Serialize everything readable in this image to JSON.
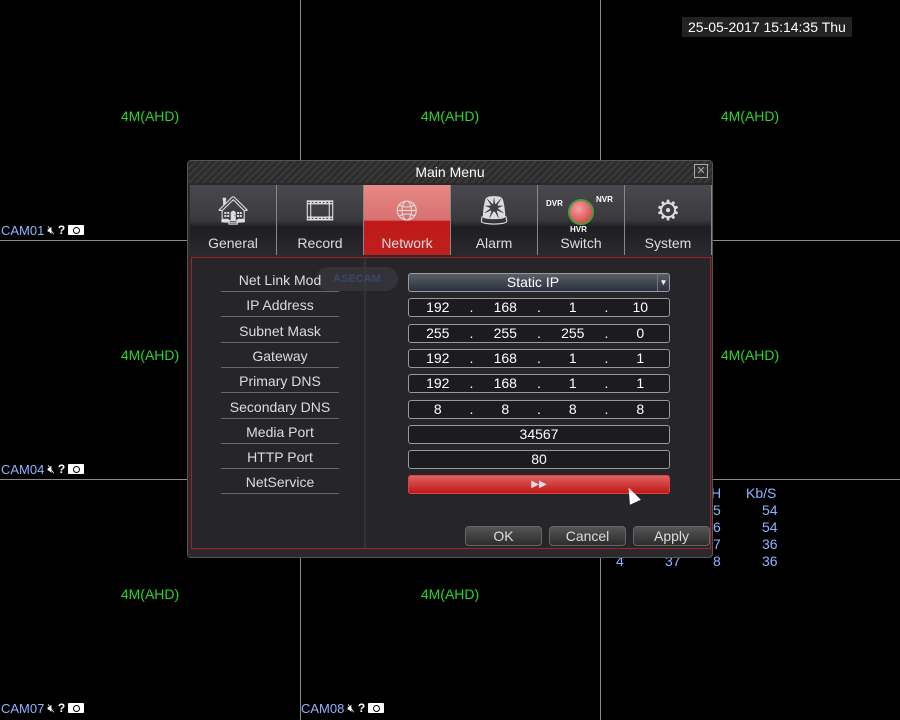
{
  "clock": "25-05-2017 15:14:35 Thu",
  "resolution": "4M(AHD)",
  "cameras": [
    {
      "label": "CAM01"
    },
    {
      "label": "CAM04"
    },
    {
      "label": "CAM07"
    },
    {
      "label": "CAM08"
    }
  ],
  "bitrate": {
    "header_ch": "H",
    "header_kbs": "Kb/S",
    "rows": [
      [
        "5",
        "54"
      ],
      [
        "6",
        "54"
      ],
      [
        "7",
        "36"
      ],
      [
        "8",
        "36"
      ]
    ],
    "partial": [
      "4",
      "37"
    ]
  },
  "dialog": {
    "title": "Main Menu",
    "tabs": [
      {
        "label": "General",
        "icon": "house-gear-icon"
      },
      {
        "label": "Record",
        "icon": "film-reel-icon"
      },
      {
        "label": "Network",
        "icon": "globe-laptop-icon",
        "active": true
      },
      {
        "label": "Alarm",
        "icon": "alarm-siren-icon"
      },
      {
        "label": "Switch",
        "icon": "dvr-nvr-hvr-switch-icon",
        "icon_text": [
          "DVR",
          "NVR",
          "HVR"
        ]
      },
      {
        "label": "System",
        "icon": "gears-icon"
      }
    ],
    "watermark": "ASECAM",
    "fields": [
      {
        "label": "Net Link Mod",
        "value": "Static IP"
      },
      {
        "label": "IP Address",
        "ip": [
          "192",
          "168",
          "1",
          "10"
        ]
      },
      {
        "label": "Subnet Mask",
        "ip": [
          "255",
          "255",
          "255",
          "0"
        ]
      },
      {
        "label": "Gateway",
        "ip": [
          "192",
          "168",
          "1",
          "1"
        ]
      },
      {
        "label": "Primary DNS",
        "ip": [
          "192",
          "168",
          "1",
          "1"
        ]
      },
      {
        "label": "Secondary DNS",
        "ip": [
          "8",
          "8",
          "8",
          "8"
        ]
      },
      {
        "label": "Media Port",
        "value": "34567"
      },
      {
        "label": "HTTP Port",
        "value": "80"
      },
      {
        "label": "NetService",
        "value": "▶▶"
      }
    ],
    "buttons": {
      "ok": "OK",
      "cancel": "Cancel",
      "apply": "Apply"
    }
  },
  "colors": {
    "accent": "#c01818",
    "resolution_text": "#2bd52b",
    "camera_label": "#8fb4ff"
  }
}
